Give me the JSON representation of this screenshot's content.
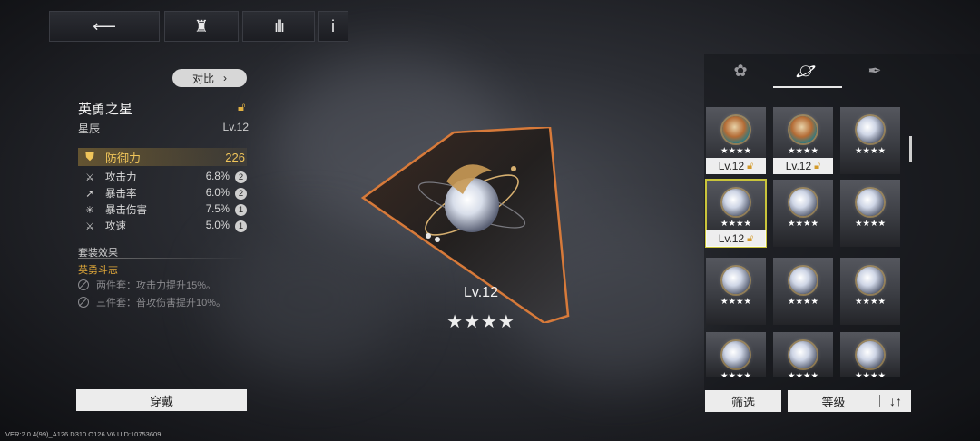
{
  "nav": {
    "back_icon": "back-arrow-icon",
    "home_icon": "castle-icon",
    "audio_icon": "waveform-icon",
    "info_label": "i"
  },
  "detail": {
    "compare_label": "对比",
    "name": "英勇之星",
    "type": "星辰",
    "level": "Lv.12",
    "main_stat": {
      "name": "防御力",
      "value": "226"
    },
    "sub_stats": [
      {
        "name": "攻击力",
        "value": "6.8%",
        "count": "2"
      },
      {
        "name": "暴击率",
        "value": "6.0%",
        "count": "2"
      },
      {
        "name": "暴击伤害",
        "value": "7.5%",
        "count": "1"
      },
      {
        "name": "攻速",
        "value": "5.0%",
        "count": "1"
      }
    ],
    "set_section": "套装效果",
    "set_name": "英勇斗志",
    "set_effects": [
      "两件套：攻击力提升15%。",
      "三件套：普攻伤害提升10%。"
    ],
    "equip_label": "穿戴"
  },
  "preview": {
    "level": "Lv.12",
    "stars": "★★★★"
  },
  "inventory": {
    "tabs": [
      "flower-icon",
      "planet-icon",
      "feather-icon"
    ],
    "items": [
      {
        "stars": "★★★★",
        "level": "Lv.12",
        "locked": true
      },
      {
        "stars": "★★★★",
        "level": "Lv.12",
        "locked": true
      },
      {
        "stars": "★★★★"
      },
      {
        "stars": "★★★★",
        "level": "Lv.12",
        "locked": true
      },
      {
        "stars": "★★★★"
      },
      {
        "stars": "★★★★"
      },
      {
        "stars": "★★★★"
      },
      {
        "stars": "★★★★"
      },
      {
        "stars": "★★★★"
      },
      {
        "stars": "★★★★"
      },
      {
        "stars": "★★★★"
      },
      {
        "stars": "★★★★"
      }
    ],
    "filter_label": "筛选",
    "sort_label": "等级",
    "sort_icon": "↓↑"
  },
  "footer": {
    "version": "VER:2.0.4(99)_A126.D310.O126.V6    UID:10753609"
  },
  "colors": {
    "accent_gold": "#e0b043",
    "selected_outline": "#c9c43b"
  }
}
